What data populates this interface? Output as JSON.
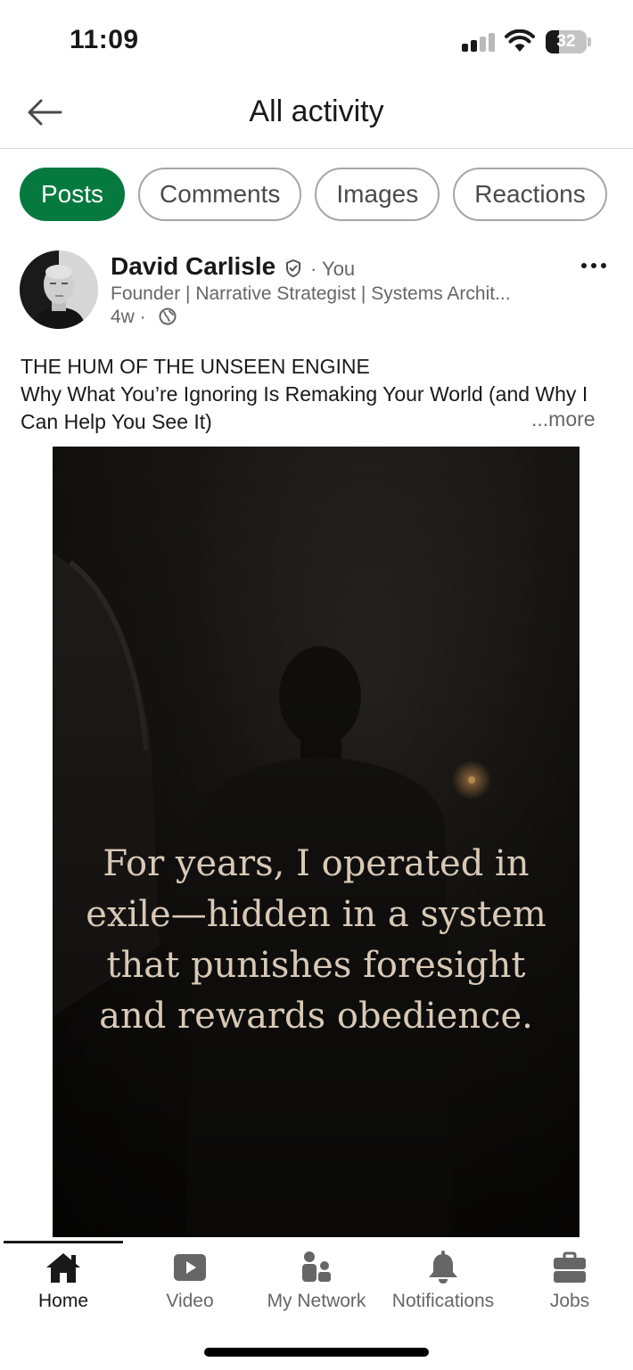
{
  "status_bar": {
    "time": "11:09",
    "battery": "32",
    "battery_level": 0.32
  },
  "header": {
    "title": "All activity"
  },
  "tabs": [
    {
      "label": "Posts",
      "active": true
    },
    {
      "label": "Comments",
      "active": false
    },
    {
      "label": "Images",
      "active": false
    },
    {
      "label": "Reactions",
      "active": false
    }
  ],
  "post": {
    "author": "David Carlisle",
    "you_label": "· You",
    "headline": "Founder | Narrative Strategist | Systems Archit...",
    "age": "4w ·",
    "text_line1": "THE HUM OF THE UNSEEN ENGINE",
    "text_line2": "Why What You’re Ignoring Is Remaking Your World (and Why I Can Help You See It)",
    "see_more": "...more",
    "image_quote": "For years, I operated in exile—hidden in a system that punishes foresight and rewards obedience."
  },
  "bottom_nav": [
    {
      "label": "Home",
      "icon": "home-icon",
      "active": true
    },
    {
      "label": "Video",
      "icon": "video-icon",
      "active": false
    },
    {
      "label": "My Network",
      "icon": "network-icon",
      "active": false
    },
    {
      "label": "Notifications",
      "icon": "bell-icon",
      "active": false
    },
    {
      "label": "Jobs",
      "icon": "briefcase-icon",
      "active": false
    }
  ],
  "colors": {
    "accent": "#06793f",
    "text": "#191919",
    "muted": "#666666"
  }
}
